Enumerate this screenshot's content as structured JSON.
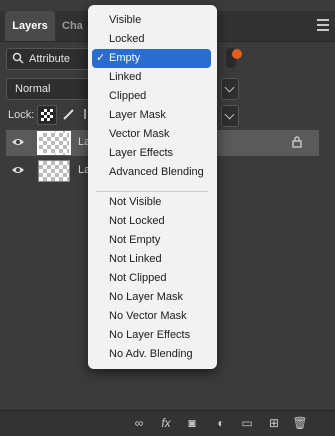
{
  "tabs": [
    {
      "label": "Layers"
    },
    {
      "label": "Cha"
    }
  ],
  "filter": {
    "selected": "Attribute"
  },
  "blend_mode": "Normal",
  "lock_label": "Lock:",
  "layers": [
    {
      "name": "La",
      "selected": true,
      "locked": true
    },
    {
      "name": "La",
      "selected": false,
      "locked": false
    }
  ],
  "dropdown": {
    "checkmark": "✓",
    "items_group1": [
      "Visible",
      "Locked",
      "Empty",
      "Linked",
      "Clipped",
      "Layer Mask",
      "Vector Mask",
      "Layer Effects",
      "Advanced Blending"
    ],
    "items_group2": [
      "Not Visible",
      "Not Locked",
      "Not Empty",
      "Not Linked",
      "Not Clipped",
      "No Layer Mask",
      "No Vector Mask",
      "No Layer Effects",
      "No Adv. Blending"
    ],
    "selected": "Empty"
  },
  "colors": {
    "accent": "#2a6ccf",
    "toggle": "#e35d1c",
    "panel": "#3b3b3b"
  },
  "bottom_icons": [
    "link-icon",
    "fx-icon",
    "mask-icon",
    "adjustment-icon",
    "folder-icon",
    "new-layer-icon",
    "trash-icon"
  ]
}
